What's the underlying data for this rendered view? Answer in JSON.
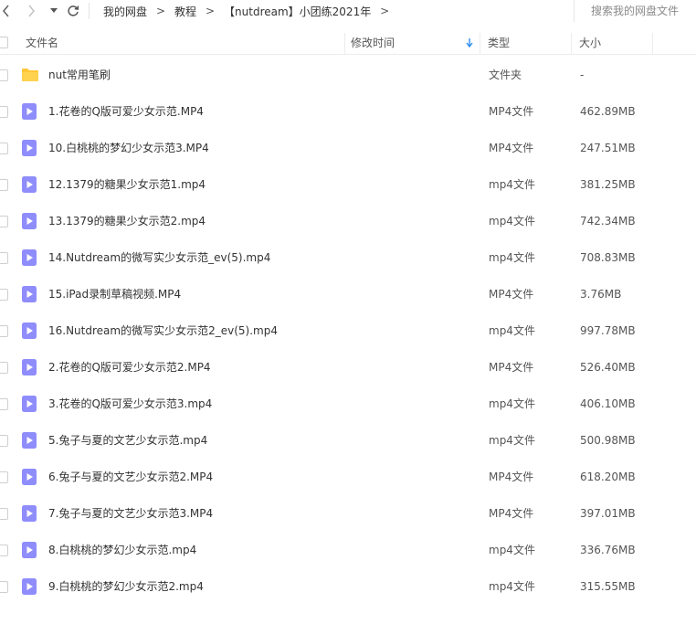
{
  "nav": {
    "back_icon": "chevron-left-icon",
    "forward_icon": "chevron-right-icon",
    "dropdown_icon": "caret-down-icon",
    "refresh_icon": "refresh-icon"
  },
  "breadcrumb": {
    "items": [
      "我的网盘",
      "教程",
      "【nutdream】小团练2021年"
    ],
    "separator": ">"
  },
  "search": {
    "placeholder": "搜索我的网盘文件"
  },
  "columns": {
    "name": "文件名",
    "modified": "修改时间",
    "type": "类型",
    "size": "大小",
    "sort_icon": "sort-down-arrow-icon"
  },
  "colors": {
    "folder": "#ffc738",
    "video": "#8f8dfb",
    "accent": "#2d8cf0"
  },
  "files": [
    {
      "name": "nut常用笔刷",
      "type": "文件夹",
      "size": "-",
      "icon": "folder-icon"
    },
    {
      "name": "1.花卷的Q版可爱少女示范.MP4",
      "type": "MP4文件",
      "size": "462.89MB",
      "icon": "video-file-icon"
    },
    {
      "name": "10.白桃桃的梦幻少女示范3.MP4",
      "type": "MP4文件",
      "size": "247.51MB",
      "icon": "video-file-icon"
    },
    {
      "name": "12.1379的糖果少女示范1.mp4",
      "type": "mp4文件",
      "size": "381.25MB",
      "icon": "video-file-icon"
    },
    {
      "name": "13.1379的糖果少女示范2.mp4",
      "type": "mp4文件",
      "size": "742.34MB",
      "icon": "video-file-icon"
    },
    {
      "name": "14.Nutdream的微写实少女示范_ev(5).mp4",
      "type": "mp4文件",
      "size": "708.83MB",
      "icon": "video-file-icon"
    },
    {
      "name": "15.iPad录制草稿视频.MP4",
      "type": "MP4文件",
      "size": "3.76MB",
      "icon": "video-file-icon"
    },
    {
      "name": "16.Nutdream的微写实少女示范2_ev(5).mp4",
      "type": "mp4文件",
      "size": "997.78MB",
      "icon": "video-file-icon"
    },
    {
      "name": "2.花卷的Q版可爱少女示范2.MP4",
      "type": "MP4文件",
      "size": "526.40MB",
      "icon": "video-file-icon"
    },
    {
      "name": "3.花卷的Q版可爱少女示范3.mp4",
      "type": "mp4文件",
      "size": "406.10MB",
      "icon": "video-file-icon"
    },
    {
      "name": "5.兔子与夏的文艺少女示范.mp4",
      "type": "mp4文件",
      "size": "500.98MB",
      "icon": "video-file-icon"
    },
    {
      "name": "6.兔子与夏的文艺少女示范2.MP4",
      "type": "MP4文件",
      "size": "618.20MB",
      "icon": "video-file-icon"
    },
    {
      "name": "7.兔子与夏的文艺少女示范3.MP4",
      "type": "MP4文件",
      "size": "397.01MB",
      "icon": "video-file-icon"
    },
    {
      "name": "8.白桃桃的梦幻少女示范.mp4",
      "type": "mp4文件",
      "size": "336.76MB",
      "icon": "video-file-icon"
    },
    {
      "name": "9.白桃桃的梦幻少女示范2.mp4",
      "type": "mp4文件",
      "size": "315.55MB",
      "icon": "video-file-icon"
    }
  ]
}
